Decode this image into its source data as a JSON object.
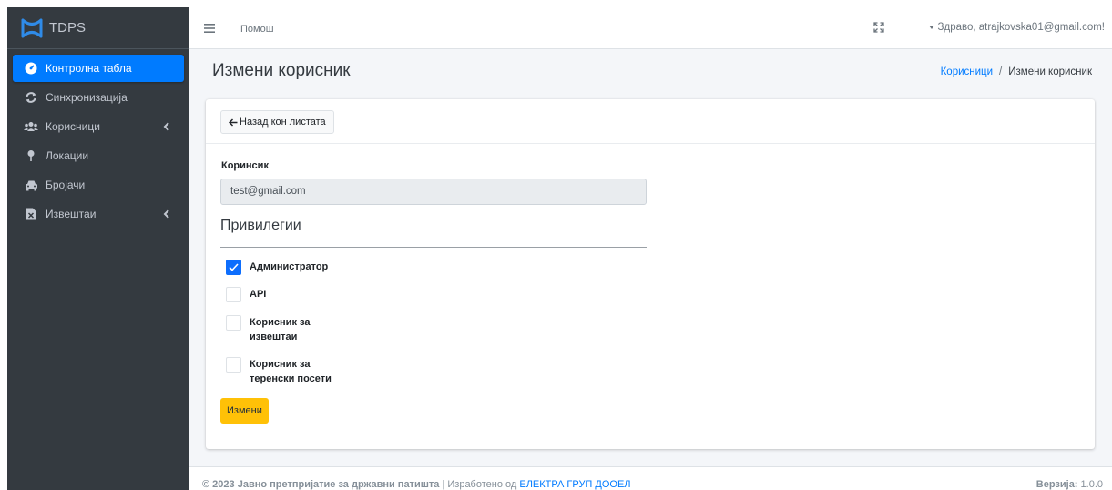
{
  "brand": {
    "name": "TDPS"
  },
  "colors": {
    "sidebar_bg": "#343a40",
    "active": "#007bff",
    "primary_button": "#ffc107",
    "link": "#007bff"
  },
  "sidebar": {
    "items": [
      {
        "label": "Контролна табла",
        "icon": "dashboard-icon",
        "active": true
      },
      {
        "label": "Синхронизација",
        "icon": "sync-icon"
      },
      {
        "label": "Корисници",
        "icon": "users-icon",
        "has_submenu": true
      },
      {
        "label": "Локации",
        "icon": "map-pin-icon"
      },
      {
        "label": "Бројачи",
        "icon": "car-icon"
      },
      {
        "label": "Извештаи",
        "icon": "report-icon",
        "has_submenu": true
      }
    ]
  },
  "header": {
    "help_label": "Помош",
    "greeting": "Здраво, atrajkovska01@gmail.com!"
  },
  "page": {
    "title": "Измени корисник",
    "breadcrumb": {
      "parent": "Корисници",
      "separator": "/",
      "current": "Измени корисник"
    }
  },
  "form": {
    "back_label": "Назад кон листата",
    "user_label": "Коринсик",
    "user_value": "test@gmail.com",
    "privileges_title": "Привилегии",
    "privileges": [
      {
        "label_line1": "Администратор",
        "label_line2": "",
        "checked": true
      },
      {
        "label_line1": "API",
        "label_line2": "",
        "checked": false
      },
      {
        "label_line1": "Корисник за",
        "label_line2": "извештаи",
        "checked": false
      },
      {
        "label_line1": "Корисник за",
        "label_line2": "теренски посети",
        "checked": false
      }
    ],
    "submit_label": "Измени"
  },
  "footer": {
    "copyright": "© 2023",
    "org": "Јавно претпријатие за државни патишта",
    "separator": "|",
    "made_by": "Изработено од",
    "company": "ЕЛЕКТРА ГРУП ДООЕЛ",
    "version_label": "Верзија:",
    "version": "1.0.0"
  }
}
